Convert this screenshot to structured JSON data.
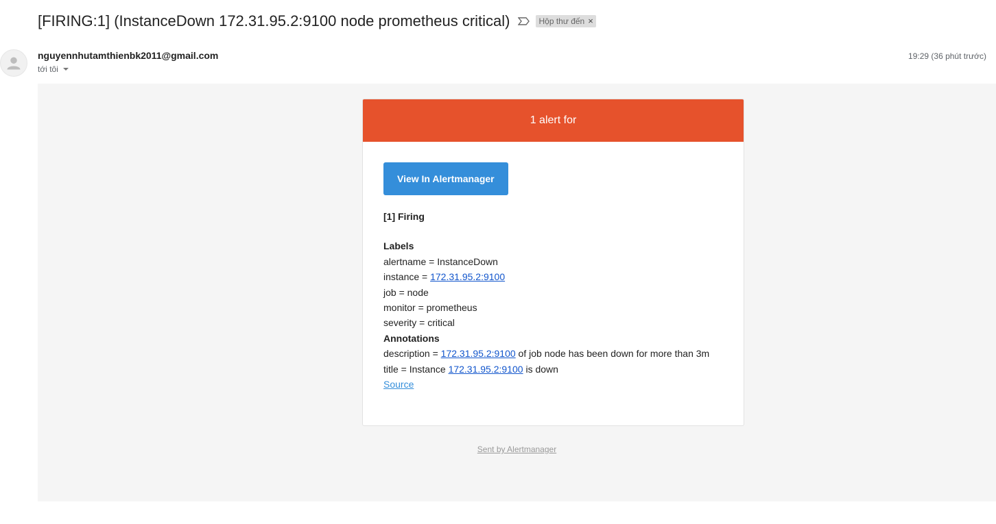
{
  "subject": "[FIRING:1] (InstanceDown 172.31.95.2:9100 node prometheus critical)",
  "icons": {
    "importance": "importance-marker-icon",
    "avatar": "person-icon",
    "caret": "caret-down-icon",
    "chip_close": "close-icon"
  },
  "label_chip": {
    "text": "Hộp thư đến",
    "close": "×"
  },
  "sender": "nguyennhutamthienbk2011@gmail.com",
  "recipient": "tới tôi",
  "timestamp": "19:29 (36 phút trước)",
  "alert": {
    "header": "1 alert for",
    "header_color": "#e6522c",
    "button_label": "View In Alertmanager",
    "button_color": "#348eda",
    "firing_title": "[1] Firing",
    "labels_title": "Labels",
    "labels": {
      "alertname": "alertname = InstanceDown",
      "instance_prefix": "instance = ",
      "instance_link": "172.31.95.2:9100",
      "job": "job = node",
      "monitor": "monitor = prometheus",
      "severity": "severity = critical"
    },
    "annotations_title": "Annotations",
    "annotations": {
      "description_prefix": "description = ",
      "description_link": "172.31.95.2:9100",
      "description_suffix": " of job node has been down for more than 3m",
      "title_prefix": "title = Instance ",
      "title_link": "172.31.95.2:9100",
      "title_suffix": " is down"
    },
    "source_label": "Source",
    "footer": "Sent by Alertmanager"
  }
}
